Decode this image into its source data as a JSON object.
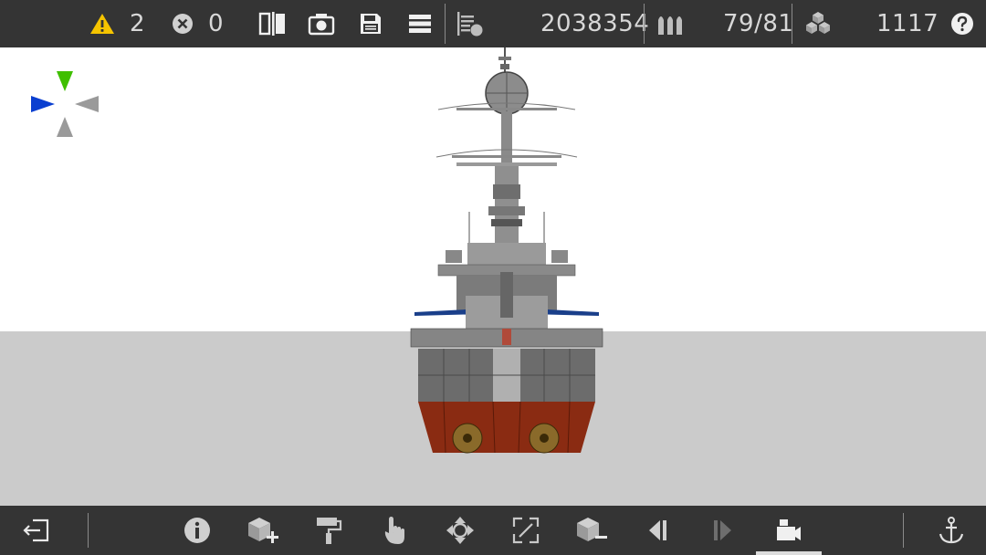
{
  "topbar": {
    "warnings_count": "2",
    "errors_count": "0",
    "mass_value": "2038354",
    "ammo_value": "79/81",
    "blocks_value": "1117",
    "icons": {
      "warning": "warning-icon",
      "error": "error-icon",
      "mirror": "mirror-icon",
      "camera": "camera-icon",
      "save": "save-icon",
      "menu": "menu-icon",
      "mass": "mass-icon",
      "ammo": "ammo-icon",
      "blocks": "blocks-icon",
      "help": "help-icon"
    },
    "colors": {
      "warning": "#f5c400",
      "bar_bg": "#343434",
      "text": "#d8d8d8"
    }
  },
  "viewport": {
    "colors": {
      "sky": "#ffffff",
      "ground": "#cbcbcb",
      "hull_upper": "#6a6a6a",
      "hull_lower": "#8a2b12",
      "axis_green": "#3fbf00",
      "axis_blue": "#0a3fd0",
      "axis_gray": "#9a9a9a"
    }
  },
  "bottombar": {
    "tools": [
      {
        "name": "exit-icon"
      },
      {
        "name": "info-icon"
      },
      {
        "name": "add-block-icon"
      },
      {
        "name": "paint-roller-icon"
      },
      {
        "name": "hand-select-icon"
      },
      {
        "name": "move-icon"
      },
      {
        "name": "resize-icon"
      },
      {
        "name": "remove-block-icon"
      },
      {
        "name": "previous-icon"
      },
      {
        "name": "next-icon"
      },
      {
        "name": "camera-view-icon"
      },
      {
        "name": "anchor-icon"
      }
    ],
    "active_tool": "camera-view-icon"
  }
}
